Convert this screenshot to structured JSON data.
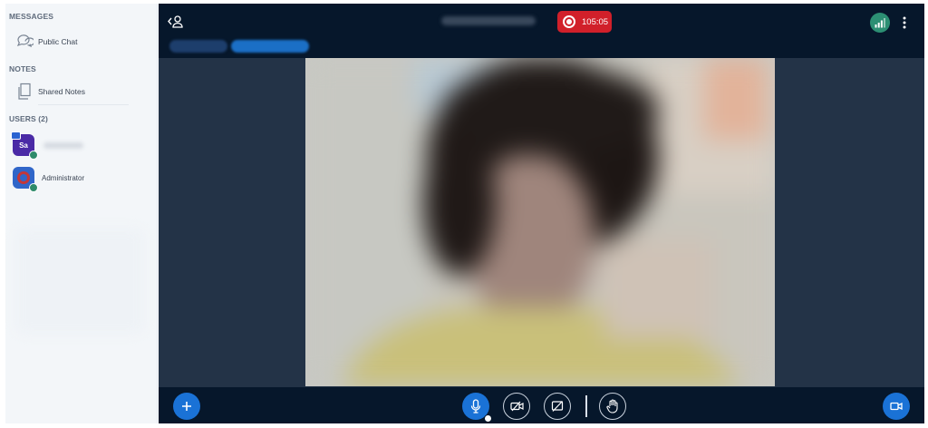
{
  "sidebar": {
    "messages_title": "MESSAGES",
    "public_chat_label": "Public Chat",
    "notes_title": "NOTES",
    "shared_notes_label": "Shared Notes",
    "users_title": "USERS (2)",
    "users": [
      {
        "initials": "Sa",
        "name": "",
        "color": "#4a2aa6",
        "presenter": true
      },
      {
        "initials": "",
        "name": "Administrator",
        "color": "#3066c9",
        "presenter": false
      }
    ]
  },
  "topbar": {
    "recording_time": "105:05",
    "recording_color": "#d1202a"
  },
  "colors": {
    "primary": "#1a72d6",
    "dark_bg": "#06172b",
    "stage_bg": "#233347",
    "status_green": "#2c8f73"
  },
  "icons": {
    "users_toggle": "user-chevron-icon",
    "connection": "signal-icon",
    "options": "more-vertical-icon",
    "add": "plus-icon",
    "mic": "microphone-icon",
    "camera": "camera-off-icon",
    "share": "screen-share-off-icon",
    "hand": "hand-raise-icon",
    "video": "video-icon"
  }
}
